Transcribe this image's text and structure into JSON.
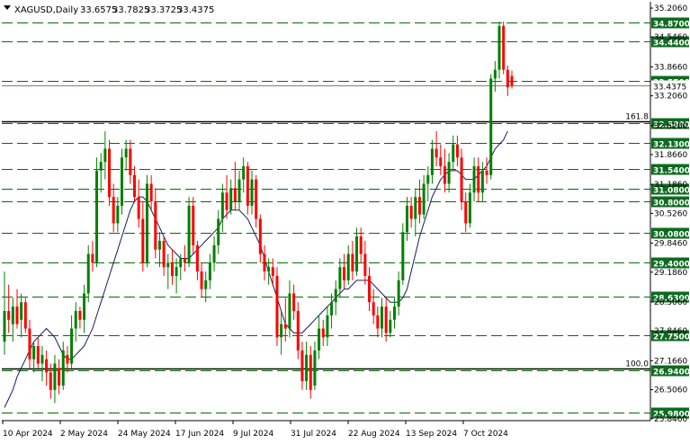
{
  "header": {
    "symbol": "XAGUSD,Daily",
    "open": "33.6575",
    "high": "33.7825",
    "low": "33.3725",
    "close": "33.4375"
  },
  "colors": {
    "background": "#ffffff",
    "bull": "#008000",
    "bear": "#ff0000",
    "grid_dash": "#007000",
    "label_bg": "#0d6b1f",
    "ma_line": "#1a1a5e",
    "axis": "#000000"
  },
  "chart_data": {
    "type": "candlestick",
    "instrument": "XAGUSD",
    "timeframe": "Daily",
    "ylim": [
      25.8,
      35.35
    ],
    "y_ticks": [
      "35.2060",
      "34.5460",
      "33.8660",
      "33.2060",
      "32.5260",
      "31.8660",
      "31.1860",
      "30.5260",
      "29.8460",
      "29.1860",
      "28.5060",
      "27.8460",
      "27.1660",
      "26.5060",
      "25.8460"
    ],
    "x_ticks": [
      "10 Apr 2024",
      "2 May 2024",
      "24 May 2024",
      "17 Jun 2024",
      "9 Jul 2024",
      "31 Jul 2024",
      "22 Aug 2024",
      "13 Sep 2024",
      "7 Oct 2024"
    ],
    "levels": [
      {
        "value": 34.87,
        "label": "34.8700"
      },
      {
        "value": 34.44,
        "label": "34.4400"
      },
      {
        "value": 33.55,
        "label": "33.5500"
      },
      {
        "value": 32.58,
        "label": "32.5800"
      },
      {
        "value": 32.13,
        "label": "32.1300"
      },
      {
        "value": 31.54,
        "label": "31.5400"
      },
      {
        "value": 31.08,
        "label": "31.0800"
      },
      {
        "value": 30.8,
        "label": "30.8000"
      },
      {
        "value": 30.08,
        "label": "30.0800"
      },
      {
        "value": 29.4,
        "label": "29.4000"
      },
      {
        "value": 28.63,
        "label": "28.6300"
      },
      {
        "value": 27.75,
        "label": "27.7500"
      },
      {
        "value": 26.94,
        "label": "26.9400"
      },
      {
        "value": 25.98,
        "label": "25.9800"
      }
    ],
    "fib_levels": [
      {
        "value": 32.58,
        "label": "161.8"
      },
      {
        "value": 26.94,
        "label": "100.0"
      }
    ],
    "current_price": {
      "value": 33.4375,
      "label": "33.4375"
    },
    "candles": [
      {
        "o": 27.6,
        "h": 29.2,
        "l": 27.3,
        "c": 28.3
      },
      {
        "o": 28.3,
        "h": 28.9,
        "l": 27.8,
        "c": 28.1
      },
      {
        "o": 28.0,
        "h": 28.6,
        "l": 27.6,
        "c": 28.4
      },
      {
        "o": 28.4,
        "h": 28.8,
        "l": 27.9,
        "c": 28.0
      },
      {
        "o": 28.1,
        "h": 28.7,
        "l": 27.7,
        "c": 28.5
      },
      {
        "o": 28.5,
        "h": 28.6,
        "l": 27.8,
        "c": 27.9
      },
      {
        "o": 27.9,
        "h": 28.1,
        "l": 27.0,
        "c": 27.2
      },
      {
        "o": 27.2,
        "h": 27.6,
        "l": 26.9,
        "c": 27.5
      },
      {
        "o": 27.5,
        "h": 27.7,
        "l": 27.0,
        "c": 27.1
      },
      {
        "o": 27.1,
        "h": 27.5,
        "l": 26.7,
        "c": 27.3
      },
      {
        "o": 27.2,
        "h": 27.4,
        "l": 26.6,
        "c": 26.9
      },
      {
        "o": 26.9,
        "h": 27.1,
        "l": 26.3,
        "c": 26.5
      },
      {
        "o": 26.5,
        "h": 27.3,
        "l": 26.2,
        "c": 27.1
      },
      {
        "o": 27.0,
        "h": 27.2,
        "l": 26.4,
        "c": 26.6
      },
      {
        "o": 26.6,
        "h": 27.6,
        "l": 26.5,
        "c": 27.4
      },
      {
        "o": 27.3,
        "h": 27.5,
        "l": 26.9,
        "c": 27.1
      },
      {
        "o": 27.1,
        "h": 28.2,
        "l": 27.0,
        "c": 27.9
      },
      {
        "o": 27.9,
        "h": 28.5,
        "l": 27.6,
        "c": 28.3
      },
      {
        "o": 28.3,
        "h": 28.4,
        "l": 27.9,
        "c": 28.1
      },
      {
        "o": 28.1,
        "h": 28.9,
        "l": 27.8,
        "c": 28.7
      },
      {
        "o": 28.7,
        "h": 29.8,
        "l": 28.5,
        "c": 29.6
      },
      {
        "o": 29.6,
        "h": 29.9,
        "l": 29.2,
        "c": 29.4
      },
      {
        "o": 29.4,
        "h": 31.8,
        "l": 29.3,
        "c": 31.5
      },
      {
        "o": 31.5,
        "h": 31.9,
        "l": 31.0,
        "c": 31.7
      },
      {
        "o": 31.7,
        "h": 32.4,
        "l": 31.3,
        "c": 32.0
      },
      {
        "o": 32.0,
        "h": 32.2,
        "l": 30.7,
        "c": 30.9
      },
      {
        "o": 30.9,
        "h": 31.2,
        "l": 30.1,
        "c": 30.3
      },
      {
        "o": 30.3,
        "h": 30.9,
        "l": 30.1,
        "c": 30.7
      },
      {
        "o": 30.7,
        "h": 32.0,
        "l": 30.5,
        "c": 31.8
      },
      {
        "o": 31.8,
        "h": 32.2,
        "l": 31.5,
        "c": 32.0
      },
      {
        "o": 32.0,
        "h": 32.2,
        "l": 31.2,
        "c": 31.4
      },
      {
        "o": 31.4,
        "h": 31.6,
        "l": 30.8,
        "c": 30.9
      },
      {
        "o": 30.9,
        "h": 31.3,
        "l": 30.2,
        "c": 30.4
      },
      {
        "o": 30.4,
        "h": 30.8,
        "l": 29.2,
        "c": 29.4
      },
      {
        "o": 29.4,
        "h": 31.4,
        "l": 29.3,
        "c": 31.2
      },
      {
        "o": 31.2,
        "h": 31.4,
        "l": 30.6,
        "c": 30.8
      },
      {
        "o": 30.8,
        "h": 31.1,
        "l": 29.5,
        "c": 29.7
      },
      {
        "o": 29.7,
        "h": 30.1,
        "l": 29.3,
        "c": 29.9
      },
      {
        "o": 29.9,
        "h": 30.0,
        "l": 29.1,
        "c": 29.3
      },
      {
        "o": 29.3,
        "h": 29.6,
        "l": 28.8,
        "c": 29.4
      },
      {
        "o": 29.4,
        "h": 29.7,
        "l": 28.9,
        "c": 29.1
      },
      {
        "o": 29.1,
        "h": 29.5,
        "l": 28.7,
        "c": 29.3
      },
      {
        "o": 29.3,
        "h": 29.6,
        "l": 29.0,
        "c": 29.5
      },
      {
        "o": 29.5,
        "h": 29.8,
        "l": 29.2,
        "c": 29.4
      },
      {
        "o": 29.4,
        "h": 30.9,
        "l": 29.3,
        "c": 30.7
      },
      {
        "o": 30.7,
        "h": 30.9,
        "l": 29.6,
        "c": 29.8
      },
      {
        "o": 29.8,
        "h": 29.9,
        "l": 29.0,
        "c": 29.2
      },
      {
        "o": 29.2,
        "h": 29.4,
        "l": 28.6,
        "c": 28.8
      },
      {
        "o": 28.8,
        "h": 29.2,
        "l": 28.5,
        "c": 29.0
      },
      {
        "o": 29.0,
        "h": 29.6,
        "l": 28.8,
        "c": 29.4
      },
      {
        "o": 29.4,
        "h": 30.0,
        "l": 29.2,
        "c": 29.8
      },
      {
        "o": 29.8,
        "h": 30.6,
        "l": 29.6,
        "c": 30.4
      },
      {
        "o": 30.4,
        "h": 31.2,
        "l": 30.1,
        "c": 31.0
      },
      {
        "o": 31.0,
        "h": 31.4,
        "l": 30.4,
        "c": 30.6
      },
      {
        "o": 30.6,
        "h": 31.3,
        "l": 30.5,
        "c": 31.1
      },
      {
        "o": 31.1,
        "h": 31.7,
        "l": 30.6,
        "c": 30.8
      },
      {
        "o": 30.8,
        "h": 31.5,
        "l": 30.6,
        "c": 31.3
      },
      {
        "o": 31.3,
        "h": 31.8,
        "l": 31.0,
        "c": 31.6
      },
      {
        "o": 31.6,
        "h": 31.7,
        "l": 30.5,
        "c": 30.7
      },
      {
        "o": 30.7,
        "h": 31.5,
        "l": 30.5,
        "c": 31.3
      },
      {
        "o": 31.3,
        "h": 31.4,
        "l": 30.2,
        "c": 30.4
      },
      {
        "o": 30.4,
        "h": 30.5,
        "l": 29.4,
        "c": 29.6
      },
      {
        "o": 29.6,
        "h": 29.8,
        "l": 29.0,
        "c": 29.2
      },
      {
        "o": 29.2,
        "h": 29.5,
        "l": 28.9,
        "c": 29.3
      },
      {
        "o": 29.3,
        "h": 29.5,
        "l": 28.9,
        "c": 29.1
      },
      {
        "o": 29.1,
        "h": 29.3,
        "l": 27.5,
        "c": 27.7
      },
      {
        "o": 27.7,
        "h": 28.3,
        "l": 27.3,
        "c": 28.0
      },
      {
        "o": 28.0,
        "h": 28.6,
        "l": 27.6,
        "c": 27.9
      },
      {
        "o": 27.9,
        "h": 29.0,
        "l": 27.7,
        "c": 28.7
      },
      {
        "o": 28.7,
        "h": 28.9,
        "l": 28.1,
        "c": 28.3
      },
      {
        "o": 28.3,
        "h": 28.5,
        "l": 27.2,
        "c": 27.4
      },
      {
        "o": 27.4,
        "h": 27.6,
        "l": 26.5,
        "c": 26.7
      },
      {
        "o": 26.7,
        "h": 27.6,
        "l": 26.5,
        "c": 27.3
      },
      {
        "o": 27.3,
        "h": 27.5,
        "l": 26.3,
        "c": 26.5
      },
      {
        "o": 26.6,
        "h": 27.6,
        "l": 26.5,
        "c": 27.4
      },
      {
        "o": 27.4,
        "h": 28.2,
        "l": 27.2,
        "c": 27.9
      },
      {
        "o": 27.9,
        "h": 28.1,
        "l": 27.5,
        "c": 27.7
      },
      {
        "o": 27.7,
        "h": 28.4,
        "l": 27.5,
        "c": 28.2
      },
      {
        "o": 28.2,
        "h": 28.7,
        "l": 27.9,
        "c": 28.5
      },
      {
        "o": 28.5,
        "h": 29.0,
        "l": 28.2,
        "c": 28.8
      },
      {
        "o": 28.8,
        "h": 29.5,
        "l": 28.6,
        "c": 29.3
      },
      {
        "o": 29.3,
        "h": 29.6,
        "l": 28.8,
        "c": 29.0
      },
      {
        "o": 29.0,
        "h": 29.8,
        "l": 28.9,
        "c": 29.6
      },
      {
        "o": 29.6,
        "h": 29.9,
        "l": 29.0,
        "c": 29.2
      },
      {
        "o": 29.2,
        "h": 30.2,
        "l": 29.1,
        "c": 30.0
      },
      {
        "o": 30.0,
        "h": 30.2,
        "l": 29.4,
        "c": 29.6
      },
      {
        "o": 29.6,
        "h": 29.9,
        "l": 28.9,
        "c": 29.1
      },
      {
        "o": 29.1,
        "h": 29.3,
        "l": 28.3,
        "c": 28.5
      },
      {
        "o": 28.5,
        "h": 28.8,
        "l": 28.0,
        "c": 28.2
      },
      {
        "o": 28.2,
        "h": 28.4,
        "l": 27.7,
        "c": 27.9
      },
      {
        "o": 27.9,
        "h": 28.6,
        "l": 27.7,
        "c": 28.4
      },
      {
        "o": 28.4,
        "h": 28.6,
        "l": 27.6,
        "c": 27.8
      },
      {
        "o": 27.8,
        "h": 28.3,
        "l": 27.7,
        "c": 28.1
      },
      {
        "o": 28.1,
        "h": 28.6,
        "l": 27.9,
        "c": 28.4
      },
      {
        "o": 28.4,
        "h": 29.2,
        "l": 28.2,
        "c": 29.0
      },
      {
        "o": 29.0,
        "h": 30.3,
        "l": 28.9,
        "c": 30.1
      },
      {
        "o": 30.1,
        "h": 30.9,
        "l": 29.9,
        "c": 30.7
      },
      {
        "o": 30.7,
        "h": 30.9,
        "l": 30.2,
        "c": 30.4
      },
      {
        "o": 30.4,
        "h": 31.1,
        "l": 30.0,
        "c": 30.9
      },
      {
        "o": 30.9,
        "h": 31.3,
        "l": 30.3,
        "c": 30.5
      },
      {
        "o": 30.5,
        "h": 31.4,
        "l": 30.4,
        "c": 31.2
      },
      {
        "o": 31.2,
        "h": 31.6,
        "l": 30.8,
        "c": 31.4
      },
      {
        "o": 31.4,
        "h": 32.2,
        "l": 31.2,
        "c": 32.0
      },
      {
        "o": 32.0,
        "h": 32.4,
        "l": 31.6,
        "c": 31.8
      },
      {
        "o": 31.8,
        "h": 32.1,
        "l": 31.4,
        "c": 31.6
      },
      {
        "o": 31.6,
        "h": 32.0,
        "l": 31.0,
        "c": 31.2
      },
      {
        "o": 31.2,
        "h": 31.9,
        "l": 31.0,
        "c": 31.7
      },
      {
        "o": 31.7,
        "h": 32.3,
        "l": 31.5,
        "c": 32.1
      },
      {
        "o": 32.1,
        "h": 32.3,
        "l": 31.6,
        "c": 31.8
      },
      {
        "o": 31.8,
        "h": 32.0,
        "l": 30.6,
        "c": 30.8
      },
      {
        "o": 30.8,
        "h": 31.0,
        "l": 30.1,
        "c": 30.3
      },
      {
        "o": 30.3,
        "h": 31.2,
        "l": 30.2,
        "c": 31.0
      },
      {
        "o": 31.0,
        "h": 31.8,
        "l": 30.8,
        "c": 31.6
      },
      {
        "o": 31.6,
        "h": 31.8,
        "l": 30.8,
        "c": 31.0
      },
      {
        "o": 31.0,
        "h": 31.7,
        "l": 30.8,
        "c": 31.5
      },
      {
        "o": 31.5,
        "h": 31.8,
        "l": 31.2,
        "c": 31.4
      },
      {
        "o": 31.4,
        "h": 33.7,
        "l": 31.3,
        "c": 33.6
      },
      {
        "o": 33.6,
        "h": 34.0,
        "l": 33.3,
        "c": 33.8
      },
      {
        "o": 33.8,
        "h": 34.9,
        "l": 33.6,
        "c": 34.8
      },
      {
        "o": 34.8,
        "h": 34.9,
        "l": 33.7,
        "c": 33.8
      },
      {
        "o": 33.8,
        "h": 33.9,
        "l": 33.2,
        "c": 33.4
      },
      {
        "o": 33.6575,
        "h": 33.7825,
        "l": 33.3725,
        "c": 33.4375
      }
    ],
    "moving_average": {
      "period_note": "",
      "values": [
        26.1,
        26.3,
        26.5,
        26.8,
        27.0,
        27.2,
        27.4,
        27.6,
        27.7,
        27.8,
        27.9,
        27.8,
        27.7,
        27.5,
        27.3,
        27.2,
        27.2,
        27.3,
        27.4,
        27.5,
        27.7,
        27.9,
        28.2,
        28.5,
        28.8,
        29.1,
        29.4,
        29.7,
        30.0,
        30.3,
        30.6,
        30.8,
        30.9,
        30.9,
        30.8,
        30.6,
        30.4,
        30.2,
        30.0,
        29.8,
        29.7,
        29.6,
        29.5,
        29.5,
        29.5,
        29.6,
        29.7,
        29.8,
        29.9,
        30.0,
        30.1,
        30.2,
        30.4,
        30.5,
        30.6,
        30.6,
        30.6,
        30.5,
        30.4,
        30.2,
        30.0,
        29.8,
        29.5,
        29.2,
        28.9,
        28.6,
        28.3,
        28.0,
        27.9,
        27.8,
        27.8,
        27.8,
        27.9,
        28.0,
        28.1,
        28.2,
        28.3,
        28.4,
        28.5,
        28.6,
        28.7,
        28.8,
        28.8,
        28.9,
        29.0,
        29.0,
        29.0,
        29.0,
        28.9,
        28.8,
        28.7,
        28.6,
        28.5,
        28.5,
        28.5,
        28.6,
        28.8,
        29.2,
        29.6,
        30.0,
        30.3,
        30.6,
        30.9,
        31.1,
        31.3,
        31.4,
        31.5,
        31.5,
        31.5,
        31.4,
        31.3,
        31.3,
        31.3,
        31.4,
        31.5,
        31.6,
        31.8,
        32.0,
        32.1,
        32.2,
        32.4
      ]
    }
  }
}
